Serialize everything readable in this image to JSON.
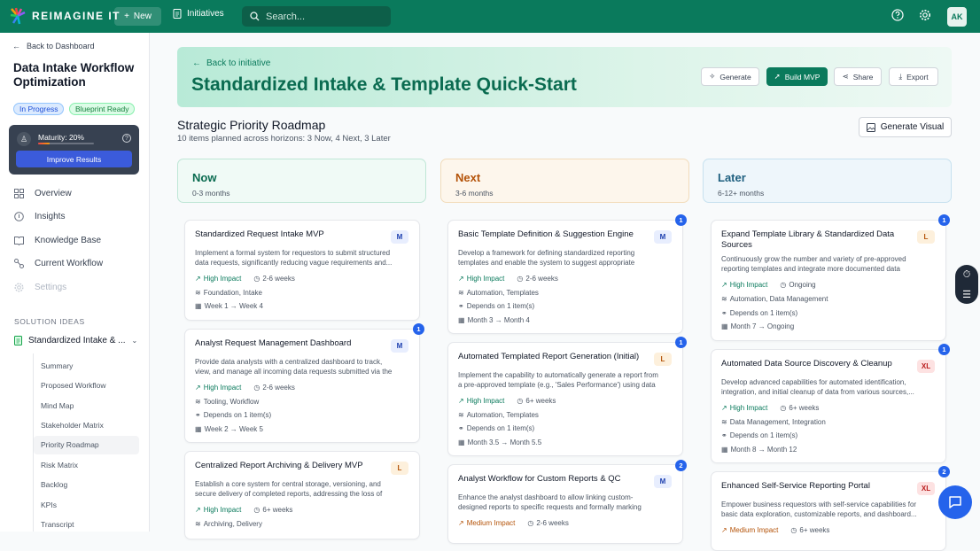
{
  "topbar": {
    "brand": "REIMAGINE IT",
    "new_label": "New",
    "initiatives_label": "Initiatives",
    "search_placeholder": "Search...",
    "avatar_initials": "AK"
  },
  "sidebar": {
    "back_label": "Back to Dashboard",
    "project_title": "Data Intake Workflow Optimization",
    "status_pill": "In Progress",
    "blueprint_pill": "Blueprint Ready",
    "maturity_label": "Maturity: 20%",
    "maturity_value": 0.2,
    "improve_label": "Improve Results",
    "nav": [
      {
        "label": "Overview",
        "icon": "grid-icon"
      },
      {
        "label": "Insights",
        "icon": "lightbulb-icon"
      },
      {
        "label": "Knowledge Base",
        "icon": "book-icon"
      },
      {
        "label": "Current Workflow",
        "icon": "workflow-icon"
      },
      {
        "label": "Settings",
        "icon": "gear-icon"
      }
    ],
    "section_header": "SOLUTION IDEAS",
    "solution_label": "Standardized Intake & ...",
    "sub_items": [
      "Summary",
      "Proposed Workflow",
      "Mind Map",
      "Stakeholder Matrix",
      "Priority Roadmap",
      "Risk Matrix",
      "Backlog",
      "KPIs",
      "Transcript"
    ],
    "active_sub": "Priority Roadmap"
  },
  "banner": {
    "back_label": "Back to initiative",
    "title": "Standardized Intake & Template Quick-Start",
    "buttons": [
      "Generate",
      "Build MVP",
      "Share",
      "Export"
    ]
  },
  "roadmap": {
    "title": "Strategic Priority Roadmap",
    "subtitle": "10 items planned across horizons: 3 Now, 4 Next, 3 Later",
    "generate_visual": "Generate Visual",
    "columns": [
      {
        "title": "Now",
        "range": "0-3 months"
      },
      {
        "title": "Next",
        "range": "3-6 months"
      },
      {
        "title": "Later",
        "range": "6-12+ months"
      }
    ],
    "cards": {
      "now": [
        {
          "title": "Standardized Request Intake MVP",
          "size": "M",
          "desc": "Implement a formal system for requestors to submit structured data requests, significantly reducing vague requirements and...",
          "impact": "High Impact",
          "duration": "2-6 weeks",
          "tags": "Foundation, Intake",
          "timeline": "Week 1 → Week 4"
        },
        {
          "title": "Analyst Request Management Dashboard",
          "size": "M",
          "dep_count": "1",
          "desc": "Provide data analysts with a centralized dashboard to track, view, and manage all incoming data requests submitted via the new...",
          "impact": "High Impact",
          "duration": "2-6 weeks",
          "tags": "Tooling, Workflow",
          "depends": "Depends on 1 item(s)",
          "timeline": "Week 2 → Week 5"
        },
        {
          "title": "Centralized Report Archiving & Delivery MVP",
          "size": "L",
          "desc": "Establish a core system for central storage, versioning, and secure delivery of completed reports, addressing the loss of institutional...",
          "impact": "High Impact",
          "duration": "6+ weeks",
          "tags": "Archiving, Delivery"
        }
      ],
      "next": [
        {
          "title": "Basic Template Definition & Suggestion Engine",
          "size": "M",
          "dep_count": "1",
          "desc": "Develop a framework for defining standardized reporting templates and enable the system to suggest appropriate templat...",
          "impact": "High Impact",
          "duration": "2-6 weeks",
          "tags": "Automation, Templates",
          "depends": "Depends on 1 item(s)",
          "timeline": "Month 3 → Month 4"
        },
        {
          "title": "Automated Templated Report Generation (Initial)",
          "size": "L",
          "dep_count": "1",
          "desc": "Implement the capability to automatically generate a report from a pre-approved template (e.g., 'Sales Performance') using data pulle...",
          "impact": "High Impact",
          "duration": "6+ weeks",
          "tags": "Automation, Templates",
          "depends": "Depends on 1 item(s)",
          "timeline": "Month 3.5 → Month 5.5"
        },
        {
          "title": "Analyst Workflow for Custom Reports & QC",
          "size": "M",
          "dep_count": "2",
          "desc": "Enhance the analyst dashboard to allow linking custom-designed reports to specific requests and formally marking quality checks a...",
          "impact": "Medium Impact",
          "duration": "2-6 weeks"
        }
      ],
      "later": [
        {
          "title": "Expand Template Library & Standardized Data Sources",
          "size": "L",
          "dep_count": "1",
          "desc": "Continuously grow the number and variety of pre-approved reporting templates and integrate more documented data sources...",
          "impact": "High Impact",
          "duration": "Ongoing",
          "tags": "Automation, Data Management",
          "depends": "Depends on 1 item(s)",
          "timeline": "Month 7 → Ongoing"
        },
        {
          "title": "Automated Data Source Discovery & Cleanup",
          "size": "XL",
          "dep_count": "1",
          "desc": "Develop advanced capabilities for automated identification, integration, and initial cleanup of data from various sources,...",
          "impact": "High Impact",
          "duration": "6+ weeks",
          "tags": "Data Management, Integration",
          "depends": "Depends on 1 item(s)",
          "timeline": "Month 8 → Month 12"
        },
        {
          "title": "Enhanced Self-Service Reporting Portal",
          "size": "XL",
          "dep_count": "2",
          "desc": "Empower business requestors with self-service capabilities for basic data exploration, customizable reports, and dashboard...",
          "impact": "Medium Impact",
          "duration": "6+ weeks"
        }
      ]
    }
  },
  "colors": {
    "brand": "#0a7a5c",
    "accent": "#2563eb",
    "now": "#0a6b50",
    "next": "#b45309",
    "later": "#1e5f7f"
  }
}
